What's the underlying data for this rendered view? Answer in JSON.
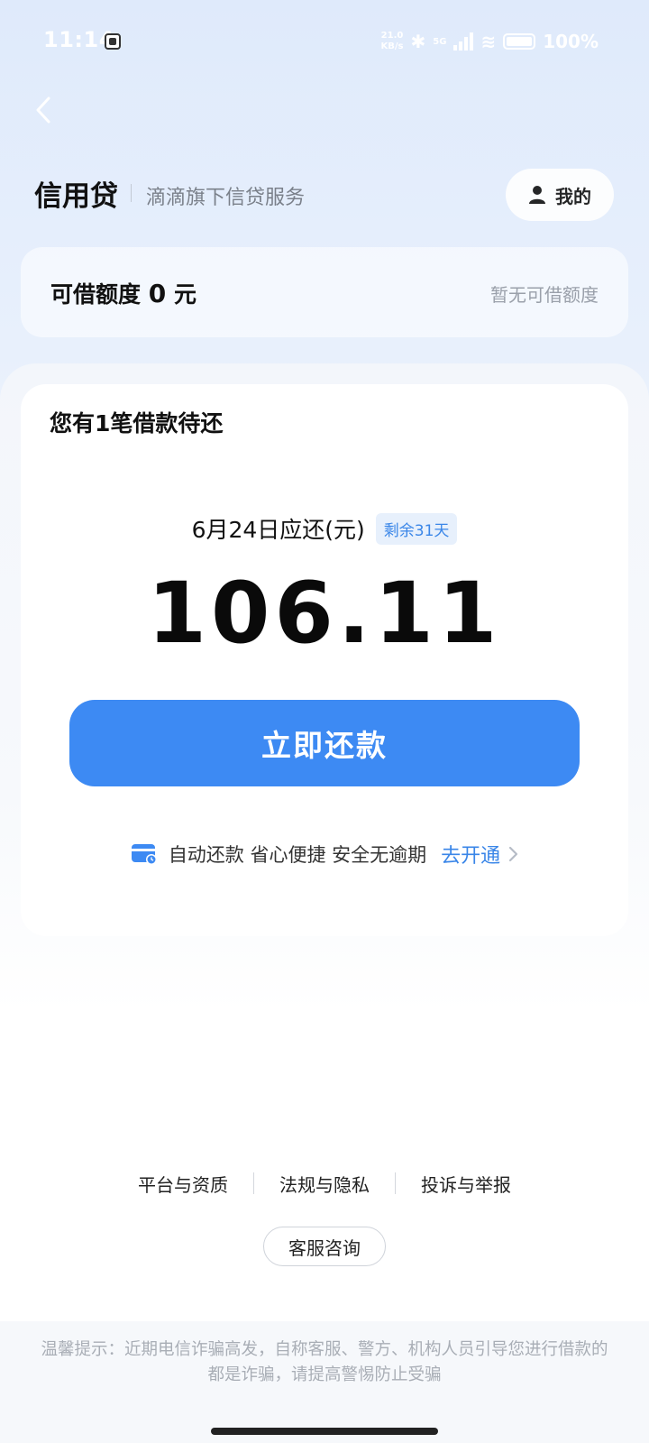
{
  "status_bar": {
    "time": "11:14",
    "net_speed_value": "21.0",
    "net_speed_unit": "KB/s",
    "network": "5G",
    "battery": "100%"
  },
  "header": {
    "title": "信用贷",
    "subtitle": "滴滴旗下信贷服务",
    "mine_label": "我的"
  },
  "credit": {
    "label_prefix": "可借额度",
    "amount": "0",
    "unit": "元",
    "status": "暂无可借额度"
  },
  "loan": {
    "heading": "您有1笔借款待还",
    "due_label": "6月24日应还(元)",
    "remaining_badge": "剩余31天",
    "amount": "106.11",
    "repay_button": "立即还款",
    "auto_repay_text": "自动还款 省心便捷 安全无逾期",
    "auto_repay_link": "去开通"
  },
  "footer": {
    "links": [
      "平台与资质",
      "法规与隐私",
      "投诉与举报"
    ],
    "support_button": "客服咨询",
    "notice": "温馨提示：近期电信诈骗高发，自称客服、警方、机构人员引导您进行借款的都是诈骗，请提高警惕防止受骗"
  },
  "colors": {
    "accent": "#3d8af3",
    "link": "#3a86e8",
    "background_top": "#dfeafb"
  }
}
